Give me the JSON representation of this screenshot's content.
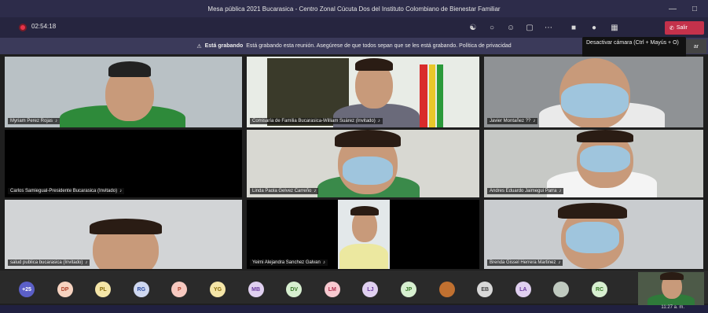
{
  "window": {
    "title": "Mesa pública 2021 Bucarasica - Centro Zonal Cúcuta Dos del Instituto Colombiano de Bienestar Familiar"
  },
  "toolbar": {
    "timer": "02:54:18",
    "leave_label": "Salir"
  },
  "banner": {
    "strong": "Está grabando",
    "text": "Está grabando esta reunión. Asegúrese de que todos sepan que se les está grabando. Política de privacidad"
  },
  "tooltip": {
    "text": "Desactivar cámara (Ctrl + Mayús + O)",
    "btn": "ar"
  },
  "participants": [
    {
      "name": "Myriam Perez Rojas"
    },
    {
      "name": "Comisaría de Familia Bucarasica-William Suárez (Invitado)"
    },
    {
      "name": "Javier Montañez ??"
    },
    {
      "name": "Carlos Samiegual-Presidente Bucarasica (Invitado)"
    },
    {
      "name": "Linda Paola Gelvez Carreño"
    },
    {
      "name": "Andres Eduardo Jaimegui Parra"
    },
    {
      "name": "salud publica bucarasica (Invitado)"
    },
    {
      "name": "Yeimi Alejandra Sanchez Galvan"
    },
    {
      "name": "Brenda Gissel Herrera Martinez"
    }
  ],
  "roster": [
    {
      "label": "+25",
      "bg": "#5b5fc7",
      "fg": "#ffffff"
    },
    {
      "label": "DP",
      "bg": "#f7d3c0",
      "fg": "#b0442c"
    },
    {
      "label": "PL",
      "bg": "#f5e6a8",
      "fg": "#8a6d0b"
    },
    {
      "label": "RG",
      "bg": "#cfd8f0",
      "fg": "#2b4a9e"
    },
    {
      "label": "P",
      "bg": "#f7c9c0",
      "fg": "#b0442c"
    },
    {
      "label": "YG",
      "bg": "#f5e6a8",
      "fg": "#8a6d0b"
    },
    {
      "label": "MB",
      "bg": "#e0d0f0",
      "fg": "#6a3a9e"
    },
    {
      "label": "DV",
      "bg": "#d7efd0",
      "fg": "#3a7a2a"
    },
    {
      "label": "LM",
      "bg": "#f7c9d0",
      "fg": "#b02c4a"
    },
    {
      "label": "LJ",
      "bg": "#e0d0f0",
      "fg": "#6a3a9e"
    },
    {
      "label": "JP",
      "bg": "#d7efd0",
      "fg": "#3a7a2a"
    },
    {
      "label": "",
      "bg": "#c07030",
      "fg": "#ffffff"
    },
    {
      "label": "EB",
      "bg": "#d8d8d8",
      "fg": "#444444"
    },
    {
      "label": "LA",
      "bg": "#e0d0f0",
      "fg": "#6a3a9e"
    },
    {
      "label": "",
      "bg": "#bfc9bf",
      "fg": "#444444"
    },
    {
      "label": "RC",
      "bg": "#d7efd0",
      "fg": "#3a7a2a"
    }
  ],
  "taskbar": {
    "time": "11:27 a. m."
  }
}
